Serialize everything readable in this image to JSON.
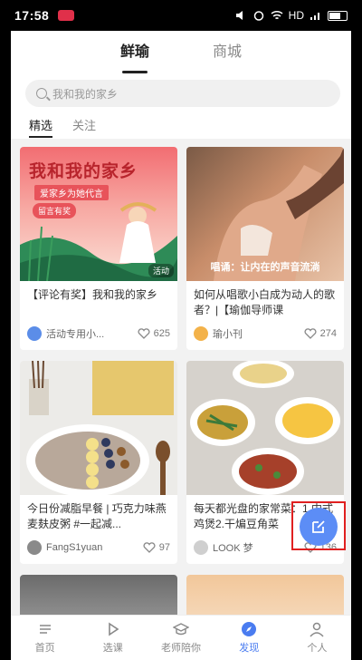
{
  "status": {
    "time": "17:58",
    "network": "HD"
  },
  "top_tabs": [
    {
      "label": "鲜瑜",
      "active": true
    },
    {
      "label": "商城",
      "active": false
    }
  ],
  "search": {
    "placeholder": "我和我的家乡"
  },
  "sub_tabs": [
    {
      "label": "精选",
      "active": true
    },
    {
      "label": "关注",
      "active": false
    }
  ],
  "cards": [
    {
      "image_title": "我和我的家乡",
      "image_sub": "爱家乡为她代言",
      "image_badge": "留言有奖",
      "image_tag": "活动",
      "title": "【评论有奖】我和我的家乡",
      "author": "活动专用小...",
      "likes": "625"
    },
    {
      "image_caption": "唱诵：让内在的声音流淌",
      "title": "如何从唱歌小白成为动人的歌者？|【瑜伽导师课",
      "author": "瑜小刊",
      "likes": "274"
    },
    {
      "title": "今日份减脂早餐 | 巧克力味燕麦麸皮粥 #一起减...",
      "author": "FangS1yuan",
      "likes": "97"
    },
    {
      "title": "每天都光盘的家常菜：1.中式鸡煲2.干煸豆角菜",
      "author": "LOOK 梦",
      "likes": "136"
    }
  ],
  "nav": [
    {
      "label": "首页",
      "icon": "home-icon",
      "active": false
    },
    {
      "label": "选课",
      "icon": "play-icon",
      "active": false
    },
    {
      "label": "老师陪你",
      "icon": "grad-cap-icon",
      "active": false
    },
    {
      "label": "发现",
      "icon": "compass-icon",
      "active": true
    },
    {
      "label": "个人",
      "icon": "person-icon",
      "active": false
    }
  ],
  "colors": {
    "accent": "#4a7cf0",
    "fab": "#5c8df6",
    "highlight_box": "#e02020"
  }
}
